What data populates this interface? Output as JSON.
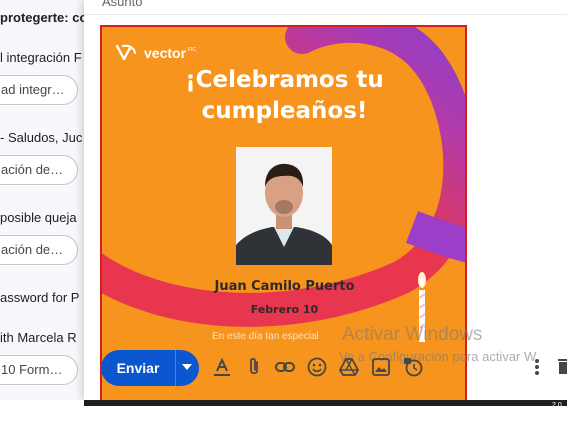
{
  "inbox": {
    "rows": [
      {
        "text": "protegerte: co",
        "bold": true
      },
      {
        "text": "l integración F",
        "bold": false
      },
      {
        "text": "ad integr…",
        "chip": true
      },
      {
        "text": "- Saludos, Juc",
        "bold": false
      },
      {
        "text": "ación de…",
        "chip": true
      },
      {
        "text": "posible queja",
        "bold": false
      },
      {
        "text": "ación de…",
        "chip": true
      },
      {
        "text": "assword for P",
        "bold": false
      },
      {
        "text": "ith Marcela R",
        "bold": false
      },
      {
        "text": "10 Form…",
        "chip": true
      }
    ]
  },
  "compose": {
    "subject_fragment": "Asunto"
  },
  "flyer": {
    "logo_text": "vector",
    "logo_sup": "FIC",
    "headline_line1": "¡Celebramos tu",
    "headline_line2": "cumpleaños!",
    "person_name": "Juan Camilo Puerto",
    "birthday_date": "Febrero 10",
    "cut_text": "En este día tan especial",
    "colors": {
      "background": "#f7941d",
      "ribbon": "#e8364f",
      "ribbon_top": "#9b3fc9"
    }
  },
  "watermark": {
    "title": "Activar Windows",
    "subtitle": "Ve a Configuración para activar W"
  },
  "toolbar": {
    "send_label": "Enviar",
    "send_color": "#0b57d0",
    "icons": [
      "format-text-icon",
      "attach-icon",
      "link-icon",
      "emoji-icon",
      "drive-icon",
      "photo-icon",
      "schedule-lock-icon"
    ]
  },
  "taskbar": {
    "tray_fragment": "2.0"
  }
}
